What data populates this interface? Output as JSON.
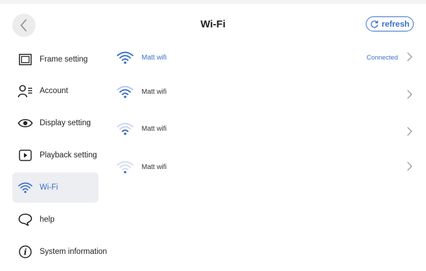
{
  "header": {
    "title": "Wi-Fi",
    "refresh_label": "refresh",
    "back_icon": "chevron-left-icon",
    "refresh_icon": "refresh-icon"
  },
  "sidebar": {
    "items": [
      {
        "label": "Frame setting",
        "icon": "frame-icon"
      },
      {
        "label": "Account",
        "icon": "account-icon"
      },
      {
        "label": "Display setting",
        "icon": "eye-icon"
      },
      {
        "label": "Playback setting",
        "icon": "play-icon"
      },
      {
        "label": "Wi-Fi",
        "icon": "wifi-icon",
        "active": true
      },
      {
        "label": "help",
        "icon": "help-icon"
      },
      {
        "label": "System information",
        "icon": "info-icon"
      }
    ]
  },
  "networks": [
    {
      "ssid": "Matt wifi",
      "status": "Connected",
      "signal": 4
    },
    {
      "ssid": "Matt wifi",
      "status": "",
      "signal": 3
    },
    {
      "ssid": "Matt wifi",
      "status": "",
      "signal": 2
    },
    {
      "ssid": "Matt wifi",
      "status": "",
      "signal": 1
    }
  ],
  "colors": {
    "accent": "#3a6fc9",
    "active_bg": "#eceef2"
  }
}
